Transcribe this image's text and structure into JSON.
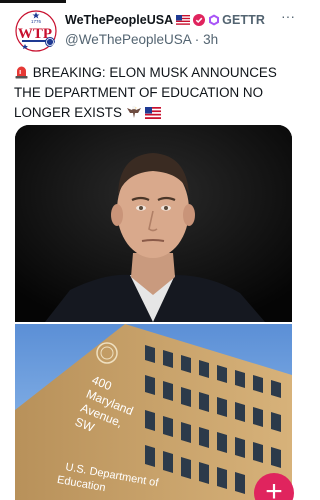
{
  "post": {
    "display_name": "WeThePeopleUSA",
    "gettr_label": "GETTR",
    "handle": "@WeThePeopleUSA",
    "separator": "·",
    "time": "3h",
    "more_label": "···",
    "text": "BREAKING: ELON MUSK ANNOUNCES THE DEPARTMENT OF EDUCATION NO LONGER EXISTS",
    "siren_icon": "siren-emoji",
    "eagle_icon": "eagle-emoji",
    "flag_icon": "us-flag-emoji"
  },
  "avatar": {
    "year": "1776",
    "letters": "WTP"
  },
  "media": {
    "building_sign": [
      "400",
      "Maryland",
      "Avenue,",
      "SW"
    ],
    "building_name": [
      "U.S. Department of",
      "Education"
    ]
  },
  "fab": {
    "label": "+"
  },
  "colors": {
    "brand_red": "#e0245e",
    "text_secondary": "#536471"
  }
}
